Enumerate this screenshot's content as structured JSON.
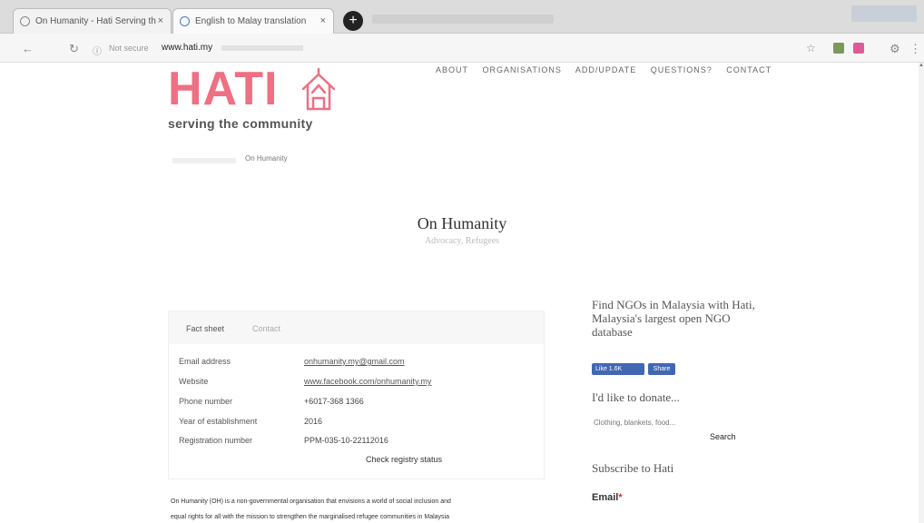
{
  "browser": {
    "tabs": [
      {
        "title": "On Humanity - Hati Serving th",
        "active": false
      },
      {
        "title": "English to Malay translation",
        "active": false
      }
    ],
    "new_tab_label": "+",
    "security_text": "Not secure",
    "url": "www.hati.my"
  },
  "site": {
    "logo_text": "HATI",
    "tagline": "serving the community",
    "nav": [
      "ABOUT",
      "ORGANISATIONS",
      "ADD/UPDATE",
      "QUESTIONS?",
      "CONTACT"
    ],
    "breadcrumb": "On Humanity"
  },
  "page": {
    "title": "On Humanity",
    "subtitle": "Advocacy, Refugees",
    "tabs": {
      "fact_sheet": "Fact sheet",
      "contact": "Contact"
    },
    "info": [
      {
        "label": "Email address",
        "value": "onhumanity.my@gmail.com"
      },
      {
        "label": "Website",
        "value": "www.facebook.com/onhumanity.my"
      },
      {
        "label": "Phone number",
        "value": "+6017-368 1366"
      },
      {
        "label": "Year of establishment",
        "value": "2016"
      },
      {
        "label": "Registration number",
        "value": "PPM-035-10-22112016"
      }
    ],
    "check_status": "Check registry status",
    "description_1": "On Humanity (OH) is a non-governmental organisation that envisions a world of social inclusion and",
    "description_2": "equal rights for all with the mission to strengthen the marginalised refugee communities in Malaysia"
  },
  "sidebar": {
    "heading": "Find NGOs in Malaysia with Hati, Malaysia's largest open NGO database",
    "fb_like": "Like 1.6K",
    "fb_share": "Share",
    "donate_heading": "I'd like to donate...",
    "donate_placeholder": "Clothing, blankets, food...",
    "search_label": "Search",
    "subscribe_heading": "Subscribe to Hati",
    "email_label": "Email",
    "email_required": "*"
  }
}
